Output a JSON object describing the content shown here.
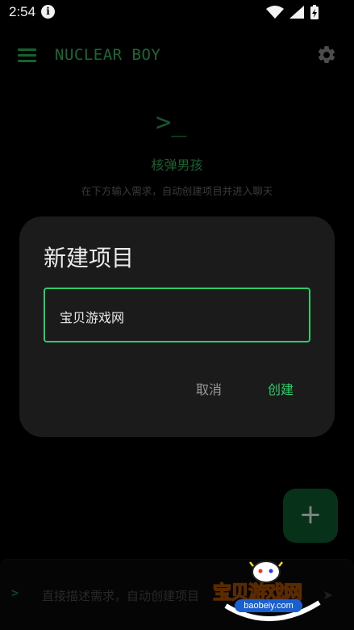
{
  "status_bar": {
    "time": "2:54",
    "icons": [
      "info-icon",
      "wifi-icon",
      "signal-icon",
      "battery-charging-icon"
    ]
  },
  "app_bar": {
    "title": "NUCLEAR BOY",
    "menu_icon": "menu-icon",
    "settings_icon": "gear-icon"
  },
  "empty_state": {
    "icon_text": ">_",
    "title": "核弹男孩",
    "subtitle": "在下方输入需求，自动创建项目并进入聊天"
  },
  "dialog": {
    "title": "新建项目",
    "input_value": "宝贝游戏网",
    "cancel_label": "取消",
    "create_label": "创建"
  },
  "fab": {
    "label": "+"
  },
  "bottom_input": {
    "prompt": ">",
    "placeholder": "直接描述需求，自动创建项目"
  },
  "watermark": {
    "text": "宝贝游戏网",
    "url": "baobeiy.com"
  },
  "colors": {
    "accent": "#2ecc6a",
    "background": "#000000",
    "dialog_bg": "#1b1b1b",
    "fab_bg": "#0f5a30"
  }
}
